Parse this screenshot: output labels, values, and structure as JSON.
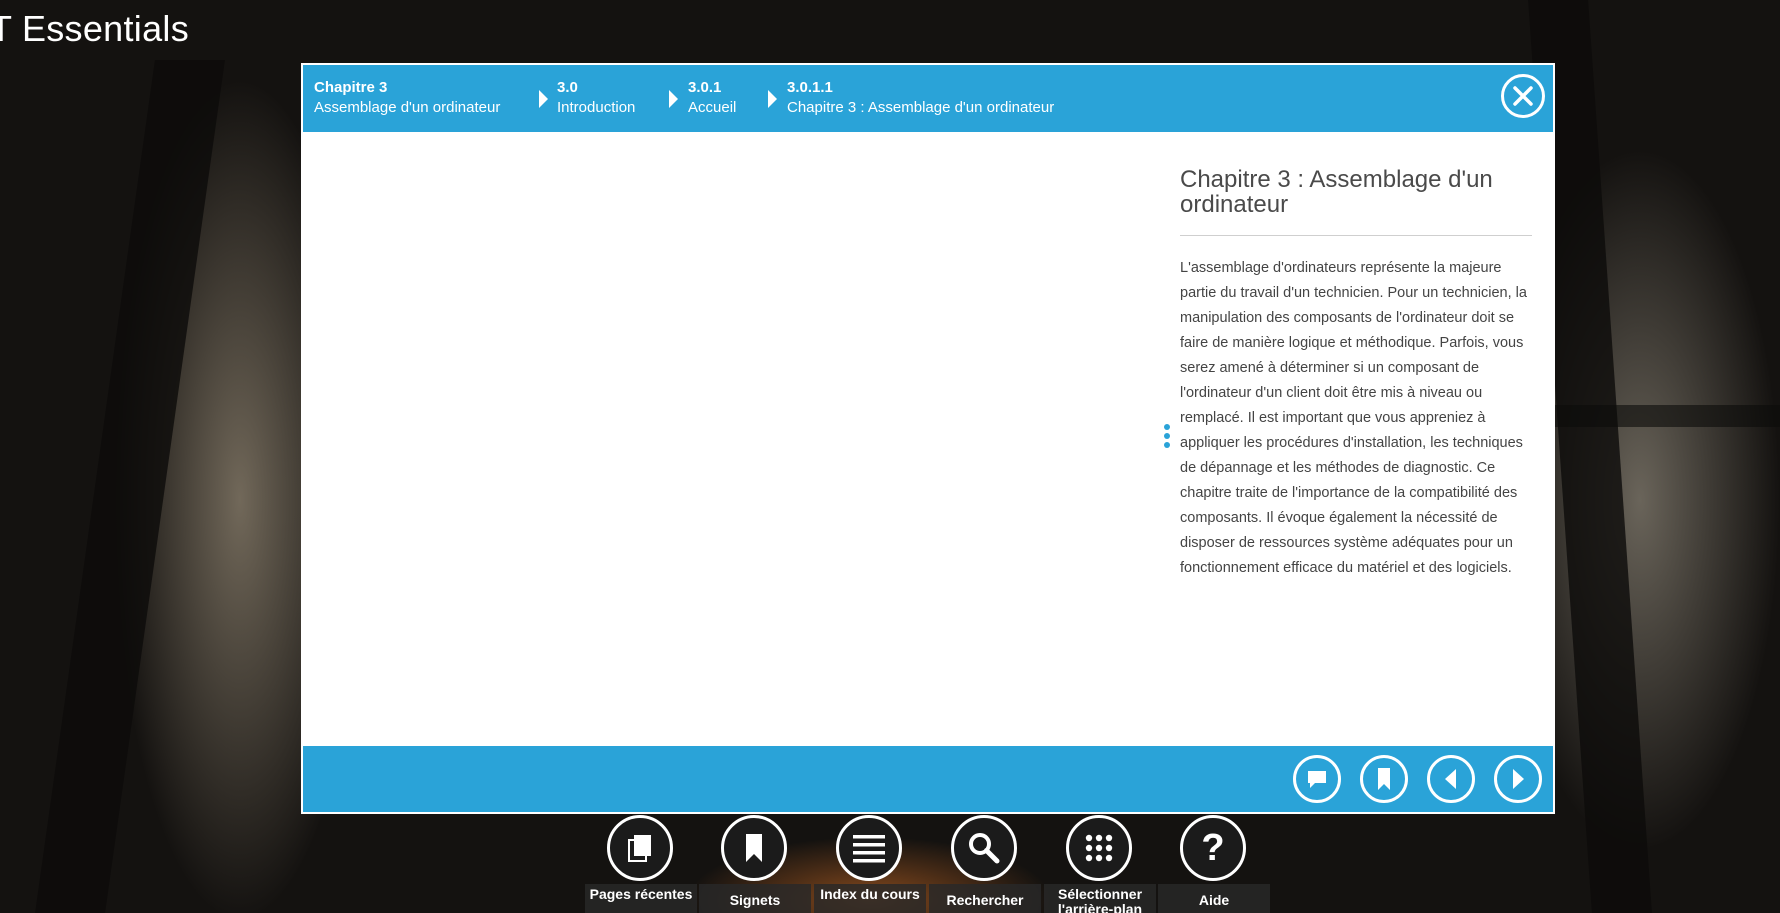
{
  "app": {
    "title": "T Essentials"
  },
  "breadcrumb": [
    {
      "num": "Chapitre 3",
      "label": "Assemblage d'un ordinateur"
    },
    {
      "num": "3.0",
      "label": "Introduction"
    },
    {
      "num": "3.0.1",
      "label": "Accueil"
    },
    {
      "num": "3.0.1.1",
      "label": "Chapitre 3 : Assemblage d'un ordinateur"
    }
  ],
  "content": {
    "title": "Chapitre 3 : Assemblage d'un ordinateur",
    "body": "L'assemblage d'ordinateurs représente la majeure partie du travail d'un technicien. Pour un technicien, la manipulation des composants de l'ordinateur doit se faire de manière logique et méthodique. Parfois, vous serez amené à déterminer si un composant de l'ordinateur d'un client doit être mis à niveau ou remplacé. Il est important que vous appreniez à appliquer les procédures d'installation, les techniques de dépannage et les méthodes de diagnostic. Ce chapitre traite de l'importance de la compatibilité des composants. Il évoque également la nécessité de disposer de ressources système adéquates pour un fonctionnement efficace du matériel et des logiciels."
  },
  "footer_icons": [
    "comment-icon",
    "bookmark-icon",
    "previous-icon",
    "next-icon"
  ],
  "dock": [
    {
      "label": "Pages récentes",
      "icon": "pages-icon"
    },
    {
      "label": "Signets",
      "icon": "bookmark-icon"
    },
    {
      "label": "Index du cours",
      "icon": "list-icon"
    },
    {
      "label": "Rechercher",
      "icon": "search-icon"
    },
    {
      "label": "Sélectionner l'arrière-plan",
      "icon": "grid-icon"
    },
    {
      "label": "Aide",
      "icon": "help-icon"
    }
  ],
  "colors": {
    "accent": "#2aa3d8",
    "panel": "#ffffff",
    "text": "#444444"
  }
}
